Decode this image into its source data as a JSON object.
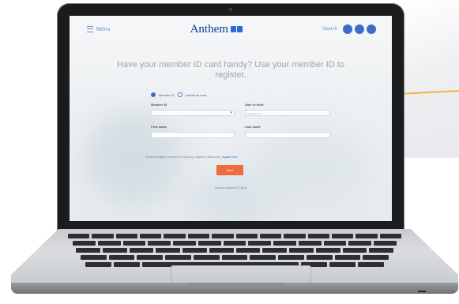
{
  "nav": {
    "menu_label": "Menu",
    "brand": "Anthem",
    "help_label": "Search"
  },
  "headline": "Have your member ID card handy? Use your member ID to register.",
  "radio": {
    "option1": "Member ID",
    "option2": "Individual code"
  },
  "form": {
    "member_id_label": "Member ID",
    "member_id_value": "",
    "dob_label": "Date of birth",
    "dob_placeholder": "MM/DD/YYYY",
    "first_name_label": "First name",
    "last_name_label": "Last name"
  },
  "note": {
    "text": "Medicaid eligible members in Kentucky, Virginia or Wisconsin:",
    "link": "register here."
  },
  "next_button": "Next",
  "footer": {
    "text": "Already registered?",
    "link": "Log in"
  },
  "colors": {
    "brand_blue": "#0a3a8f",
    "accent_blue": "#3c6cc9",
    "button_orange": "#ec6b3f"
  }
}
